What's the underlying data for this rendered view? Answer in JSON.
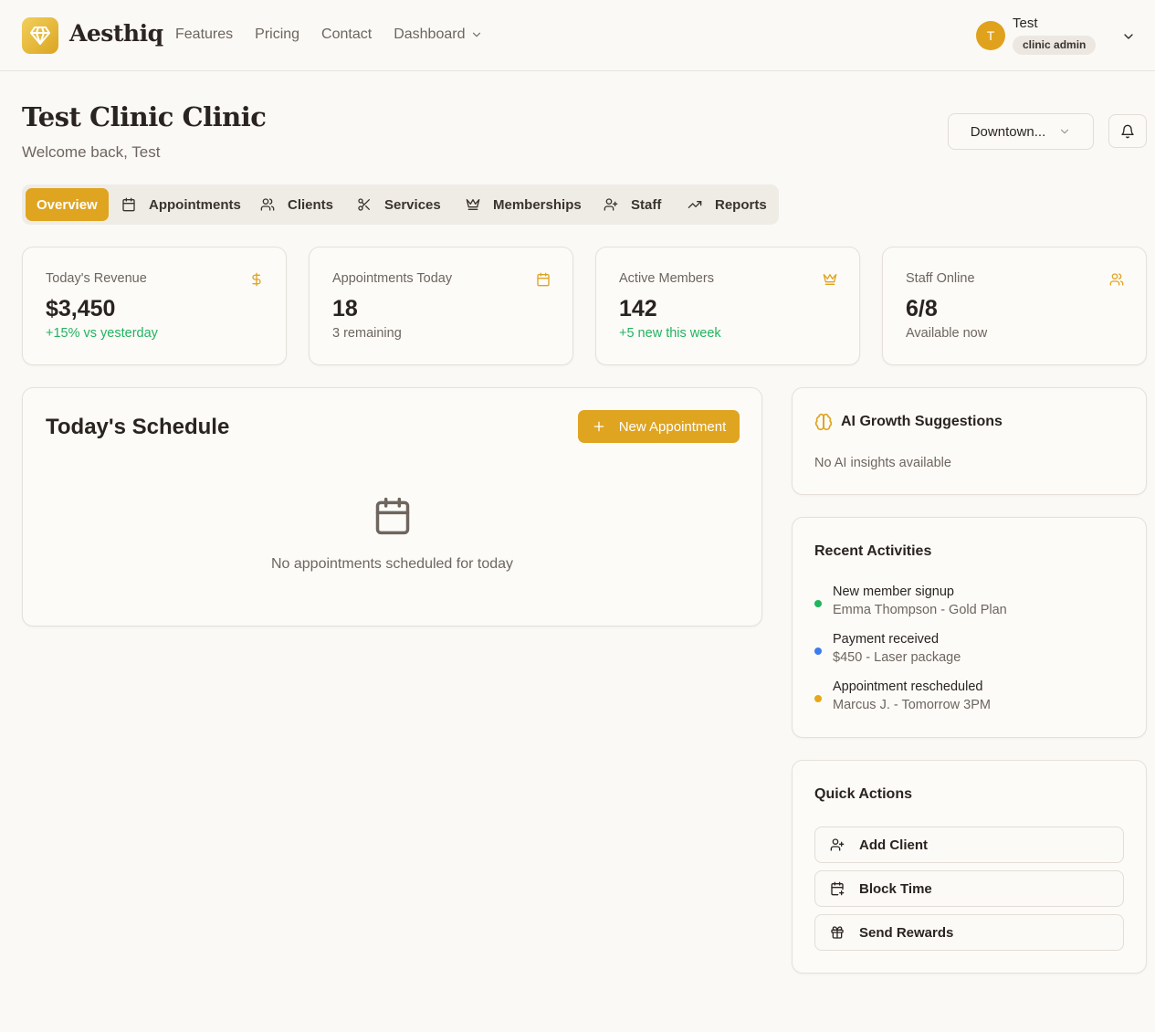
{
  "header": {
    "brand": "Aesthiq",
    "nav": [
      {
        "label": "Features"
      },
      {
        "label": "Pricing"
      },
      {
        "label": "Contact"
      },
      {
        "label": "Dashboard"
      }
    ],
    "user": {
      "initial": "T",
      "name": "Test",
      "role": "clinic admin"
    }
  },
  "page": {
    "title": "Test Clinic Clinic",
    "welcome": "Welcome back, Test",
    "location_select": "Downtown..."
  },
  "tabs": [
    {
      "label": "Overview",
      "icon": "none"
    },
    {
      "label": "Appointments",
      "icon": "calendar-icon"
    },
    {
      "label": "Clients",
      "icon": "users-icon"
    },
    {
      "label": "Services",
      "icon": "scissors-icon"
    },
    {
      "label": "Memberships",
      "icon": "crown-icon"
    },
    {
      "label": "Staff",
      "icon": "user-plus-icon"
    },
    {
      "label": "Reports",
      "icon": "trending-up-icon"
    }
  ],
  "stats": [
    {
      "label": "Today's Revenue",
      "value": "$3,450",
      "sub": "+15% vs yesterday",
      "icon": "dollar-icon"
    },
    {
      "label": "Appointments Today",
      "value": "18",
      "sub": "3 remaining",
      "icon": "calendar-icon"
    },
    {
      "label": "Active Members",
      "value": "142",
      "sub": "+5 new this week",
      "icon": "crown-icon"
    },
    {
      "label": "Staff Online",
      "value": "6/8",
      "sub": "Available now",
      "icon": "users-icon"
    }
  ],
  "schedule": {
    "title": "Today's Schedule",
    "new_button": "New Appointment",
    "empty_text": "No appointments scheduled for today"
  },
  "ai": {
    "title": "AI Growth Suggestions",
    "empty_text": "No AI insights available"
  },
  "activities": {
    "title": "Recent Activities",
    "items": [
      {
        "title": "New member signup",
        "detail": "Emma Thompson - Gold Plan",
        "color": "#22b35e"
      },
      {
        "title": "Payment received",
        "detail": "$450 - Laser package",
        "color": "#3b7ded"
      },
      {
        "title": "Appointment rescheduled",
        "detail": "Marcus J. - Tomorrow 3PM",
        "color": "#e6a817"
      }
    ]
  },
  "quick_actions": {
    "title": "Quick Actions",
    "items": [
      {
        "label": "Add Client",
        "icon": "user-plus-icon"
      },
      {
        "label": "Block Time",
        "icon": "calendar-plus-icon"
      },
      {
        "label": "Send Rewards",
        "icon": "gift-icon"
      }
    ]
  },
  "colors": {
    "accent": "#dfa420",
    "positive": "#22b35e",
    "background": "#faf9f6"
  }
}
